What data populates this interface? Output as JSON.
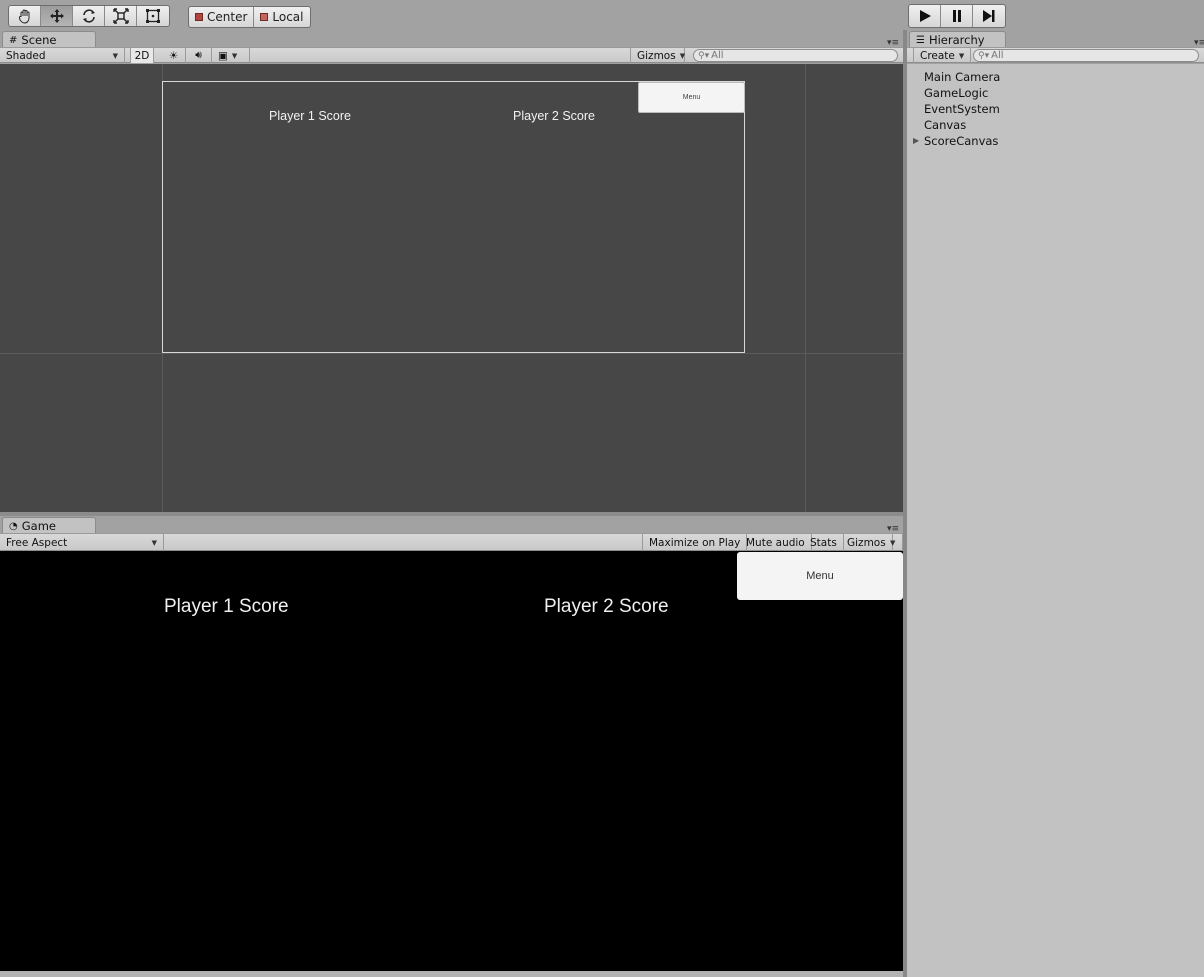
{
  "toolbar": {
    "tools": [
      "hand-tool",
      "move-tool",
      "rotate-tool",
      "scale-tool",
      "rect-tool"
    ],
    "active_tool": "move-tool",
    "pivot_mode": "Center",
    "pivot_rotation": "Local"
  },
  "scene": {
    "tab_label": "Scene",
    "shading_mode": "Shaded",
    "mode_2d_label": "2D",
    "gizmos_label": "Gizmos",
    "search_placeholder": "All",
    "player1_score": "Player 1 Score",
    "player2_score": "Player 2 Score",
    "menu_button": "Menu"
  },
  "game": {
    "tab_label": "Game",
    "aspect": "Free Aspect",
    "maximize_on_play": "Maximize on Play",
    "mute_audio": "Mute audio",
    "stats": "Stats",
    "gizmos_label": "Gizmos",
    "player1_score": "Player 1 Score",
    "player2_score": "Player 2 Score",
    "menu_button": "Menu"
  },
  "hierarchy": {
    "tab_label": "Hierarchy",
    "create_label": "Create",
    "search_placeholder": "All",
    "items": [
      "Main Camera",
      "GameLogic",
      "EventSystem",
      "Canvas",
      "ScoreCanvas"
    ]
  },
  "colors": {
    "editor_bg": "#a2a2a2",
    "scene_bg": "#474747",
    "game_bg": "#000000",
    "panel_bg": "#c2c2c2"
  }
}
